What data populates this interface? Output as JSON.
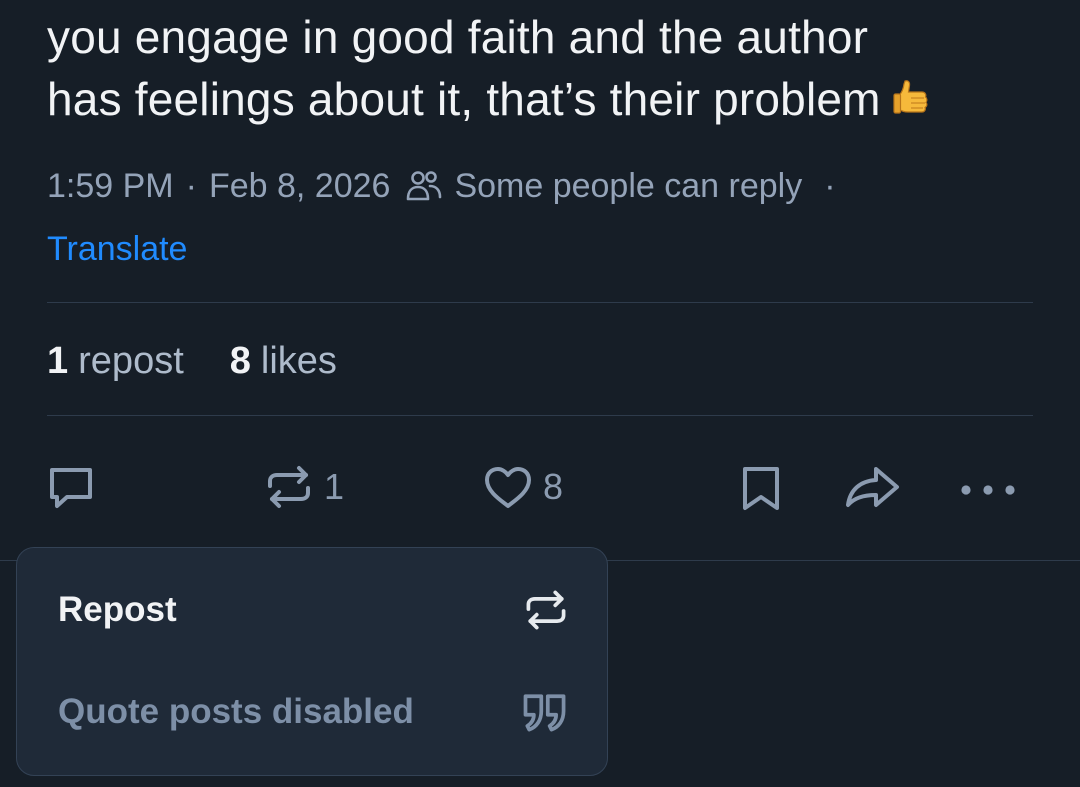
{
  "post": {
    "text_line1": "you engage in good faith and the author",
    "text_line2": "has feelings about it, that’s their problem",
    "emoji": "thumbs-up-emoji",
    "time": "1:59 PM",
    "separator": "·",
    "date": "Feb 8, 2026",
    "reply_setting": "Some people can reply",
    "trailing_separator": "·",
    "translate_label": "Translate"
  },
  "stats": {
    "reposts_count": "1",
    "reposts_label": "repost",
    "likes_count": "8",
    "likes_label": "likes"
  },
  "actions": {
    "reply_icon": "speech-bubble-icon",
    "repost_icon": "repost-arrows-icon",
    "repost_count": "1",
    "like_icon": "heart-icon",
    "like_count": "8",
    "bookmark_icon": "bookmark-icon",
    "share_icon": "share-arrow-icon",
    "more_icon": "ellipsis-icon"
  },
  "repost_menu": {
    "repost_label": "Repost",
    "repost_icon": "repost-arrows-icon",
    "quote_label": "Quote posts disabled",
    "quote_icon": "quote-marks-icon",
    "quote_disabled": true
  },
  "colors": {
    "background": "#161e27",
    "text": "#f1f3f5",
    "muted": "#94a3b8",
    "link": "#208bfe",
    "menu_background": "#1f2a38",
    "divider": "#2e3b4b"
  }
}
